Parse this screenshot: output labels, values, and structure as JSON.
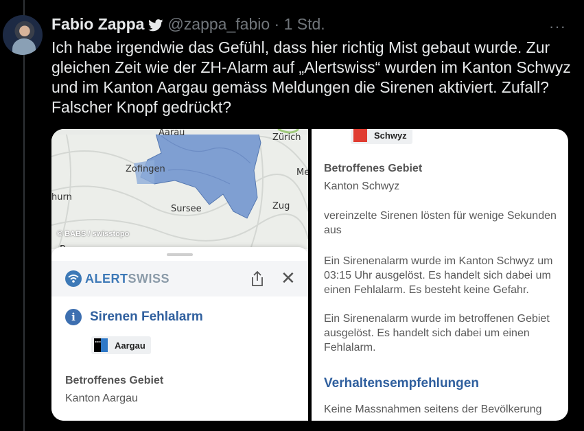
{
  "tweet": {
    "author_name": "Fabio Zappa",
    "author_handle": "@zappa_fabio",
    "dot": "·",
    "time": "1 Std.",
    "more_menu": "···",
    "text": "Ich habe irgendwie das Gefühl, dass hier richtig Mist gebaut wurde. Zur gleichen Zeit wie der ZH-Alarm auf „Alertswiss“ wurden im Kanton Schwyz und im Kanton Aargau gemäss Meldungen die Sirenen aktiviert. Zufall? Falscher Knopf gedrückt?"
  },
  "icons": {
    "verified": "twitter-bird-icon",
    "avatar": "avatar",
    "share": "share-icon",
    "close": "close-icon",
    "info": "info-icon"
  },
  "colors": {
    "background": "#000000",
    "text": "#e7e9ea",
    "muted": "#71767b",
    "alert_blue": "#2f5f9e",
    "map_area": "#7f9fd2"
  },
  "left_screenshot": {
    "map_labels": {
      "aarau": "Aarau",
      "zurich": "Zürich",
      "zofingen": "Zofingen",
      "me": "Me",
      "thurn": "hurn",
      "sursee": "Sursee",
      "zug": "Zug",
      "b": "B"
    },
    "map_attribution": "© BABS / swisstopo",
    "app_logo_alert": "ALERT",
    "app_logo_swiss": "SWISS",
    "close_glyph": "✕",
    "info_glyph": "i",
    "alert_title": "Sirenen Fehlalarm",
    "canton_chip": "Aargau",
    "affected_area_label": "Betroffenes Gebiet",
    "affected_area_value": "Kanton Aargau"
  },
  "right_screenshot": {
    "canton_chip": "Schwyz",
    "affected_area_label": "Betroffenes Gebiet",
    "affected_area_value": "Kanton Schwyz",
    "paragraph_1": "vereinzelte Sirenen lösten für wenige Sekunden aus",
    "paragraph_2": "Ein Sirenenalarm wurde im Kanton Schwyz um 03:15 Uhr ausgelöst. Es handelt sich dabei um einen Fehlalarm. Es besteht keine Gefahr.",
    "paragraph_3": "Ein Sirenenalarm wurde im betroffenen Gebiet ausgelöst. Es handelt sich dabei um einen Fehlalarm.",
    "recommendations_heading": "Verhaltensempfehlungen",
    "recommendations_text": "Keine Massnahmen seitens der Bevölkerung"
  }
}
